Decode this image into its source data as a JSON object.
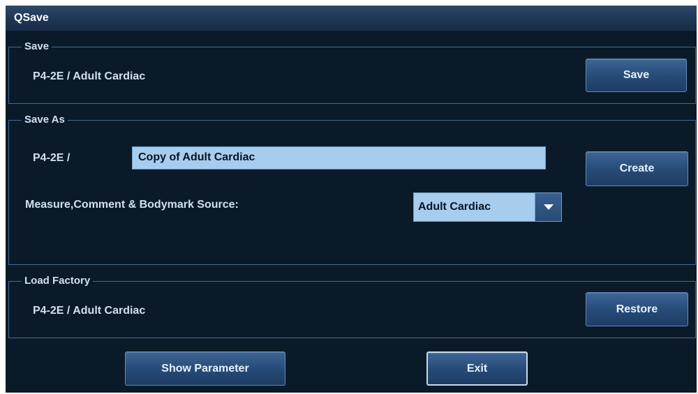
{
  "window": {
    "title": "QSave"
  },
  "save": {
    "legend": "Save",
    "preset": "P4-2E  /  Adult Cardiac",
    "button": "Save"
  },
  "save_as": {
    "legend": "Save As",
    "prefix": "P4-2E  /",
    "name_value": "Copy of Adult Cardiac",
    "create_button": "Create",
    "source_label": "Measure,Comment & Bodymark Source:",
    "source_selected": "Adult Cardiac"
  },
  "load_factory": {
    "legend": "Load Factory",
    "preset": "P4-2E  /  Adult Cardiac",
    "button": "Restore"
  },
  "footer": {
    "show_parameter_button": "Show Parameter",
    "exit_button": "Exit"
  },
  "icons": {
    "dropdown": "chevron-down-icon"
  },
  "colors": {
    "background": "#0b1a29",
    "titlebar": "#1e3655",
    "border": "#3f6d9b",
    "field": "#a6cdee",
    "button": "#274c78",
    "text": "#cfe0f0"
  }
}
